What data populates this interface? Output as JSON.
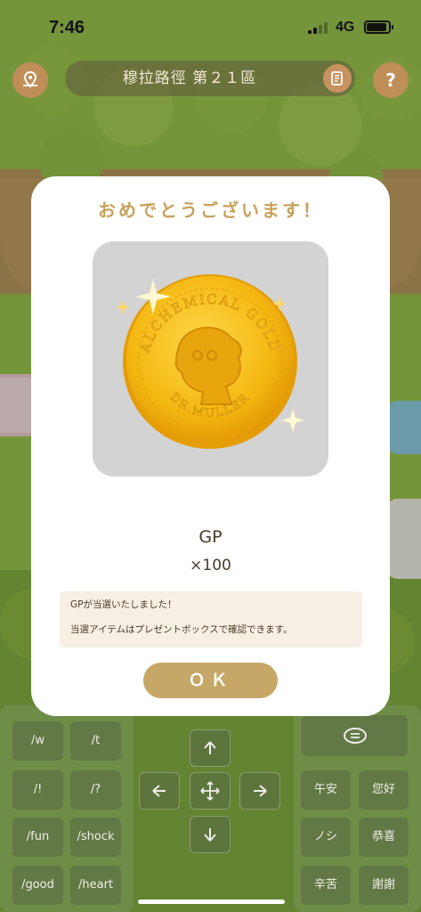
{
  "status_bar": {
    "time": "7:46",
    "network": "4G",
    "icons": [
      "signal-icon",
      "battery-icon"
    ]
  },
  "top_bar": {
    "location": "穆拉路徑 第２１區",
    "left_icon": "map-pin-icon",
    "memo_icon": "memo-icon",
    "help_label": "?"
  },
  "modal": {
    "title": "おめでとうございます！",
    "prize": {
      "coin_top_text": "ALCHEMICAL GOLD",
      "coin_bottom_text": "DR.MULLER",
      "name": "GP",
      "quantity": "×100"
    },
    "message_line1": "GPが当選いたしました！",
    "message_line2": "当選アイテムはプレゼントボックスで確認できます。",
    "ok_label": "ＯＫ"
  },
  "controls": {
    "emotes": [
      "/w",
      "/t",
      "/!",
      "/?",
      "/fun",
      "/shock",
      "/good",
      "/heart"
    ],
    "greetings": [
      "午安",
      "您好",
      "ノシ",
      "恭喜",
      "辛苦",
      "謝謝"
    ],
    "chat_icon": "chat-bubble-icon",
    "dpad_icons": [
      "arrow-up-icon",
      "arrow-left-icon",
      "move-icon",
      "arrow-right-icon",
      "arrow-down-icon"
    ]
  },
  "colors": {
    "title_gold": "#c8a15a",
    "ok_button": "#c6a767",
    "message_bg": "#f7efe4",
    "coin_gold": "#f4b812"
  }
}
